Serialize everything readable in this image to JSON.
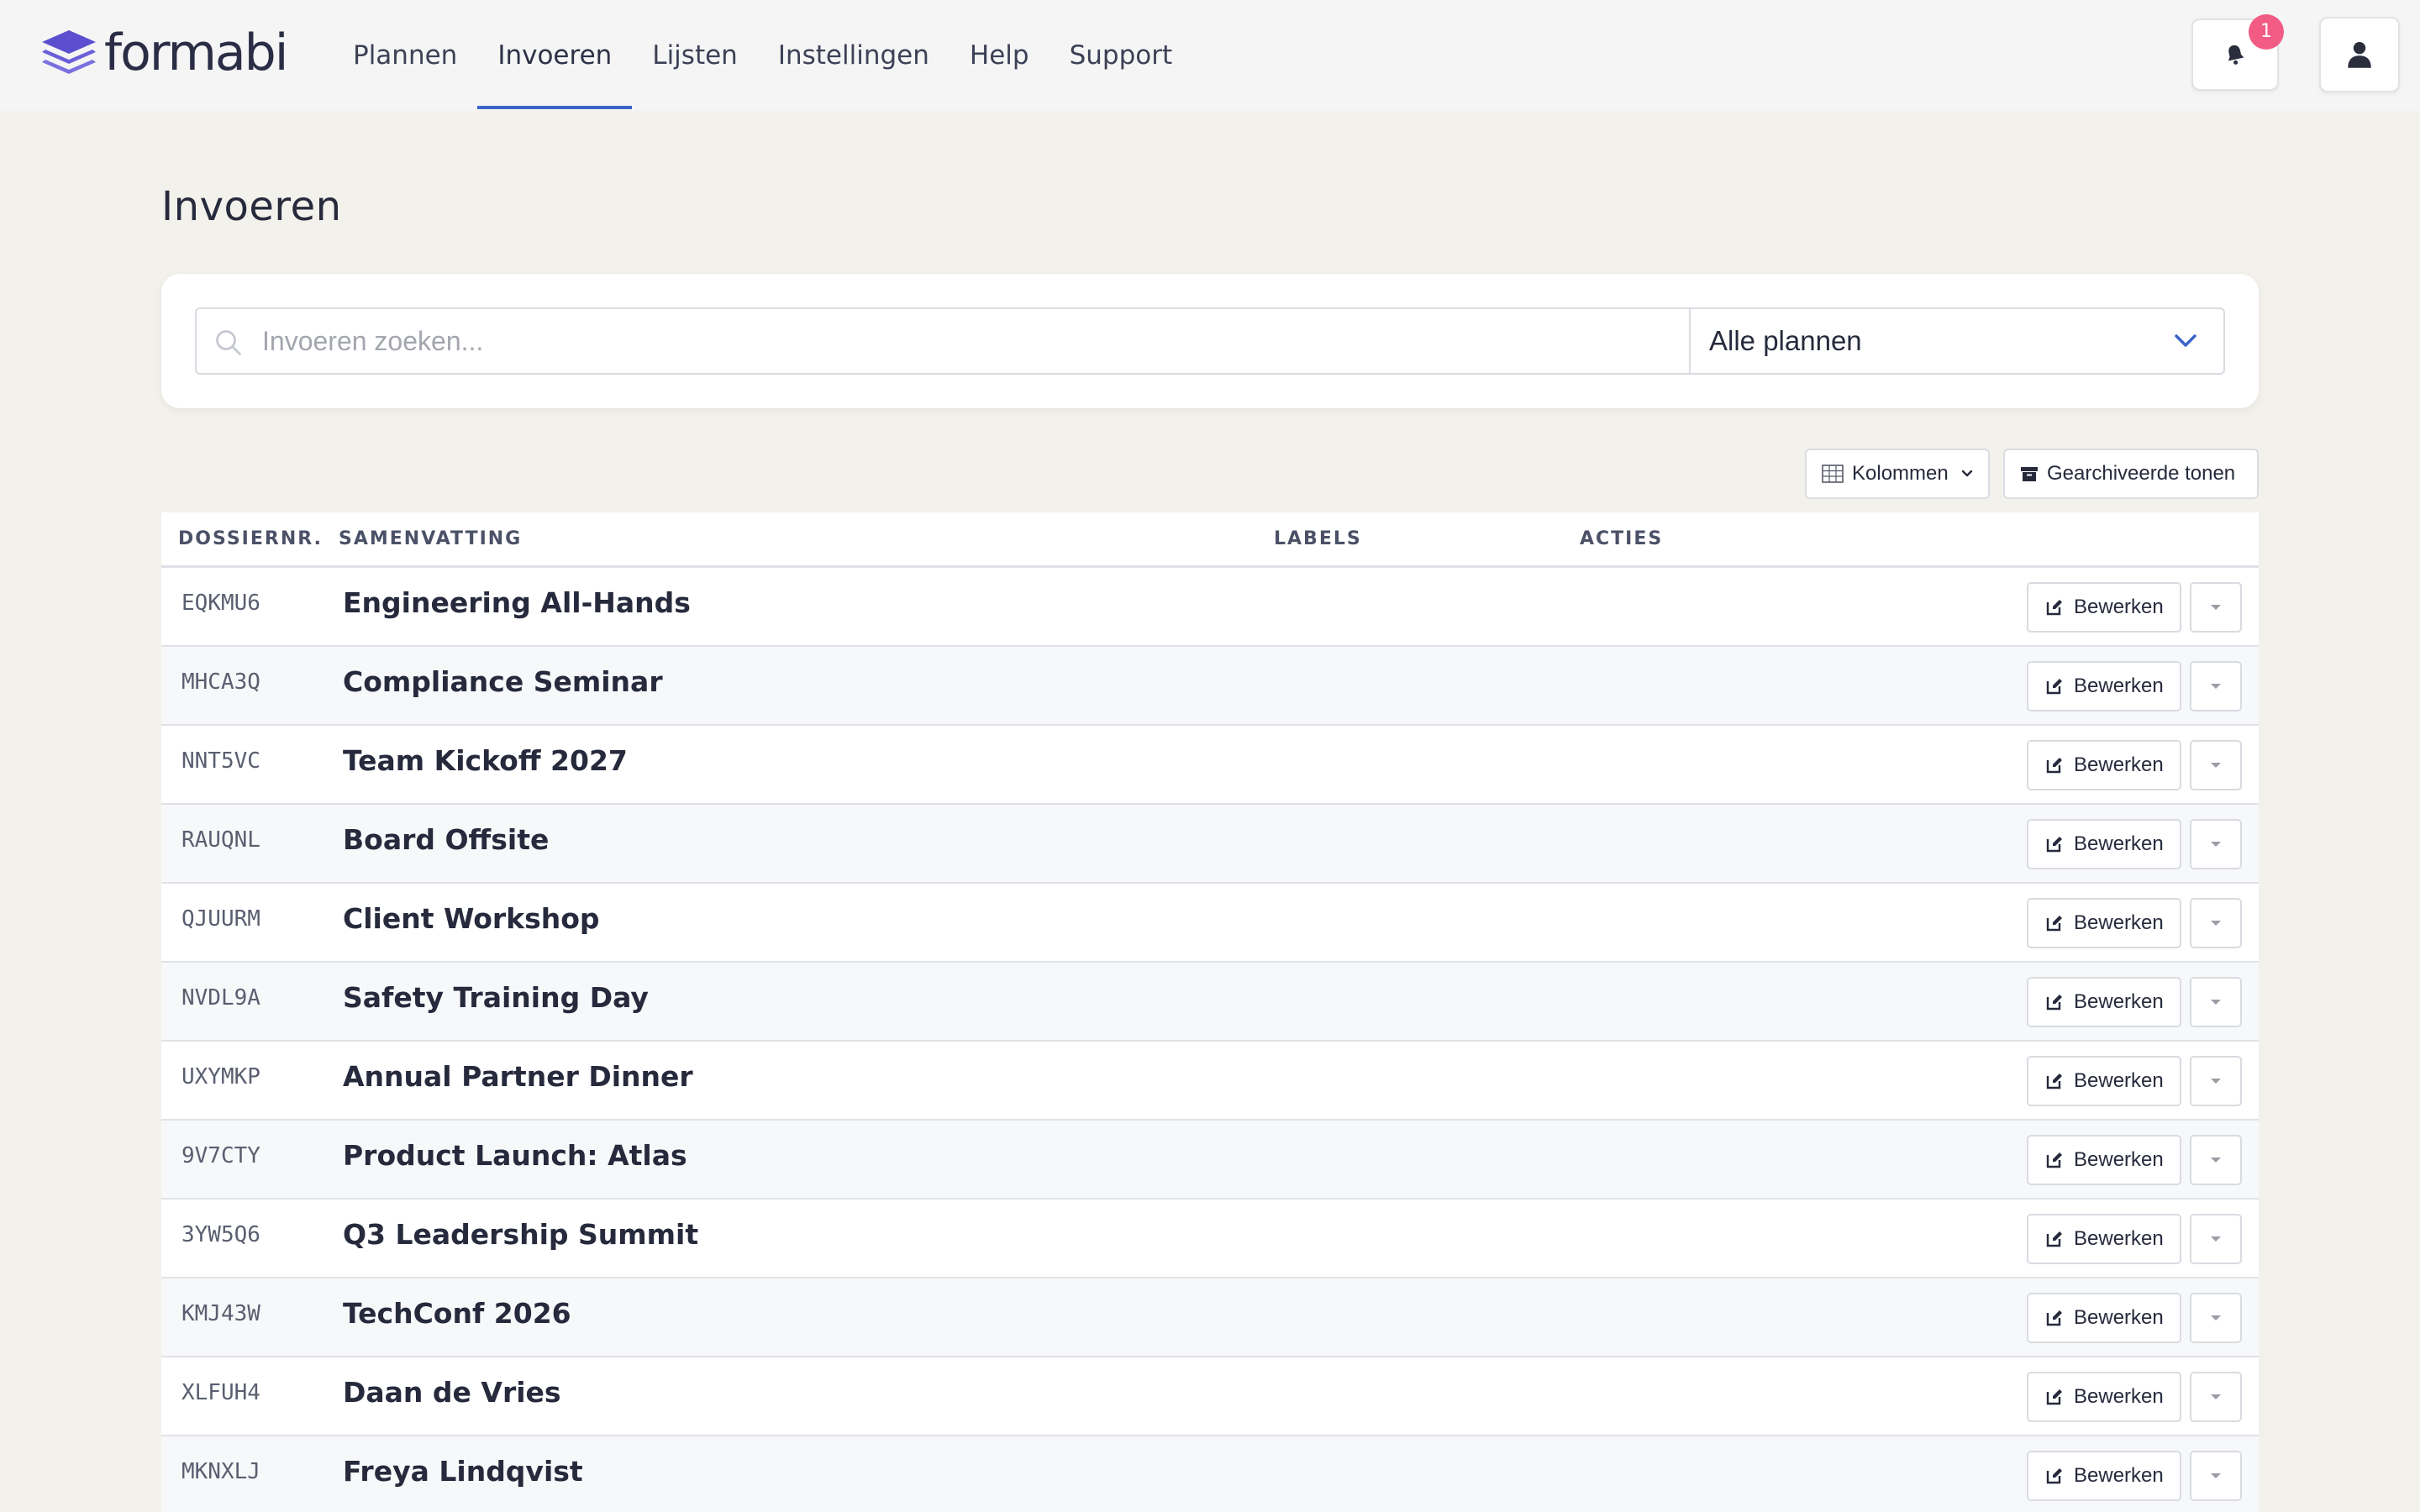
{
  "app": {
    "logo_text": "formabi",
    "brand_color": "#5b4fcf"
  },
  "nav": {
    "items": [
      {
        "label": "Plannen",
        "active": false
      },
      {
        "label": "Invoeren",
        "active": true
      },
      {
        "label": "Lijsten",
        "active": false
      },
      {
        "label": "Instellingen",
        "active": false
      },
      {
        "label": "Help",
        "active": false
      },
      {
        "label": "Support",
        "active": false
      }
    ],
    "notification_icon": "bell-icon",
    "notification_count": "1",
    "user_icon": "user-icon"
  },
  "page": {
    "title": "Invoeren"
  },
  "search": {
    "placeholder": "Invoeren zoeken...",
    "value": "",
    "plan_filter": "Alle plannen"
  },
  "toolbar": {
    "columns_label": "Kolommen",
    "archived_label": "Gearchiveerde tonen"
  },
  "table": {
    "headers": {
      "id": "DOSSIERNR.",
      "summary": "SAMENVATTING",
      "labels": "LABELS",
      "actions": "ACTIES"
    },
    "edit_label": "Bewerken",
    "rows": [
      {
        "id": "EQKMU6",
        "summary": "Engineering All-Hands"
      },
      {
        "id": "MHCA3Q",
        "summary": "Compliance Seminar"
      },
      {
        "id": "NNT5VC",
        "summary": "Team Kickoff 2027"
      },
      {
        "id": "RAUQNL",
        "summary": "Board Offsite"
      },
      {
        "id": "QJUURM",
        "summary": "Client Workshop"
      },
      {
        "id": "NVDL9A",
        "summary": "Safety Training Day"
      },
      {
        "id": "UXYMKP",
        "summary": "Annual Partner Dinner"
      },
      {
        "id": "9V7CTY",
        "summary": "Product Launch: Atlas"
      },
      {
        "id": "3YW5Q6",
        "summary": "Q3 Leadership Summit"
      },
      {
        "id": "KMJ43W",
        "summary": "TechConf 2026"
      },
      {
        "id": "XLFUH4",
        "summary": "Daan de Vries"
      },
      {
        "id": "MKNXLJ",
        "summary": "Freya Lindqvist"
      }
    ]
  }
}
